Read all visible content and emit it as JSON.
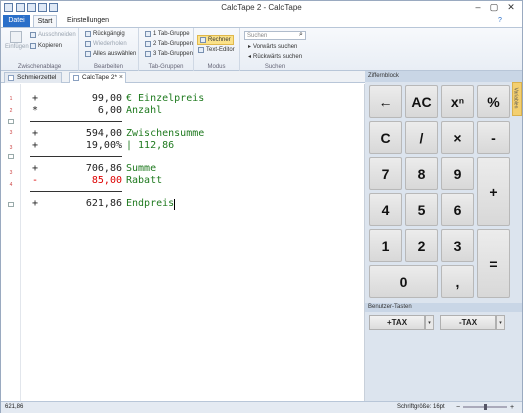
{
  "window": {
    "title": "CalcTape 2 - CalcTape"
  },
  "ribbon": {
    "tabs": {
      "file": "Datei",
      "start": "Start",
      "settings": "Einstellungen"
    },
    "clipboard": {
      "paste": "Einfügen",
      "cut": "Ausschneiden",
      "copy": "Kopieren",
      "label": "Zwischenablage"
    },
    "edit": {
      "undo": "Rückgängig",
      "redo": "Wiederholen",
      "select_all": "Alles auswählen",
      "label": "Bearbeiten"
    },
    "tabgroups": {
      "one": "1 Tab-Gruppe",
      "two": "2 Tab-Gruppen",
      "three": "3 Tab-Gruppen",
      "label": "Tab-Gruppen"
    },
    "mode": {
      "calculator": "Rechner",
      "text_editor": "Text-Editor",
      "label": "Modus"
    },
    "search": {
      "placeholder": "Suchen",
      "forward": "Vorwärts suchen",
      "backward": "Rückwärts suchen",
      "label": "Suchen"
    }
  },
  "doc_tabs": [
    {
      "label": "Schmierzettel"
    },
    {
      "label": "CalcTape 2*"
    }
  ],
  "tape": {
    "lines": [
      {
        "op": "+",
        "value": "99,00",
        "comment": "€ Einzelpreis"
      },
      {
        "op": "*",
        "value": "6,00",
        "comment": "Anzahl"
      },
      {
        "op": "+",
        "value": "594,00",
        "comment": "Zwischensumme"
      },
      {
        "op": "+",
        "value": "19,00%",
        "comment": "| 112,86"
      },
      {
        "op": "+",
        "value": "706,86",
        "comment": "Summe"
      },
      {
        "op": "-",
        "value": "85,00",
        "comment": "Rabatt"
      },
      {
        "op": "+",
        "value": "621,86",
        "comment": "Endpreis"
      }
    ]
  },
  "panel": {
    "keypad_title": "Ziffernblock",
    "variables_tab": "Variablen",
    "user_keys_title": "Benutzer-Tasten"
  },
  "keys": {
    "back": "←",
    "ac": "AC",
    "pow": "xⁿ",
    "pct": "%",
    "c": "C",
    "div": "/",
    "mul": "×",
    "minus": "-",
    "k7": "7",
    "k8": "8",
    "k9": "9",
    "plus": "+",
    "k4": "4",
    "k5": "5",
    "k6": "6",
    "k1": "1",
    "k2": "2",
    "k3": "3",
    "eq": "=",
    "k0": "0",
    "comma": ","
  },
  "user_keys": {
    "tax_plus": "+TAX",
    "tax_minus": "-TAX",
    "dropdown": "▾"
  },
  "status": {
    "result": "621,86",
    "font_size": "Schriftgröße: 16pt"
  }
}
